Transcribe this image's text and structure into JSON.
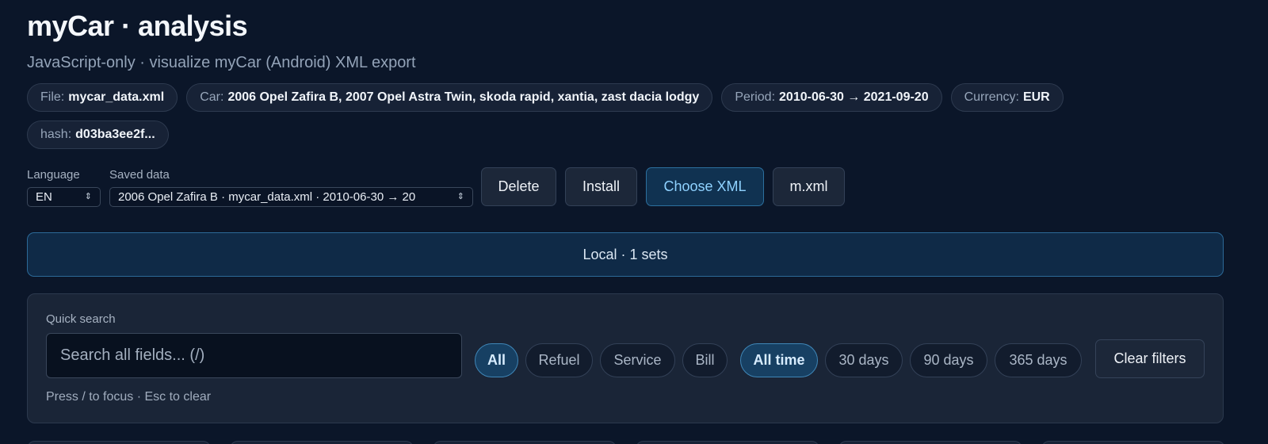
{
  "header": {
    "title": "myCar · analysis",
    "subtitle": "JavaScript-only · visualize myCar (Android) XML export"
  },
  "meta_chips": [
    {
      "label": "File:",
      "value": "mycar_data.xml"
    },
    {
      "label": "Car:",
      "value": "2006 Opel Zafira B, 2007 Opel Astra Twin, skoda rapid, xantia, zast dacia lodgy"
    },
    {
      "label": "Period:",
      "value": "2010-06-30 → 2021-09-20"
    },
    {
      "label": "Currency:",
      "value": "EUR"
    },
    {
      "label": "hash:",
      "value": "d03ba3ee2f..."
    }
  ],
  "controls": {
    "language_label": "Language",
    "language_value": "EN",
    "saved_label": "Saved data",
    "saved_value": "2006 Opel Zafira B · mycar_data.xml · 2010-06-30 → 20",
    "delete_label": "Delete",
    "install_label": "Install",
    "choose_label": "Choose XML",
    "file_label": "m.xml"
  },
  "local_bar": "Local · 1 sets",
  "filters": {
    "search_label": "Quick search",
    "search_placeholder": "Search all fields... (/)",
    "hint": "Press / to focus · Esc to clear",
    "type_pills": [
      "All",
      "Refuel",
      "Service",
      "Bill"
    ],
    "time_pills": [
      "All time",
      "30 days",
      "90 days",
      "365 days"
    ],
    "active_type": "All",
    "active_time": "All time",
    "clear_label": "Clear filters"
  },
  "colors": {
    "background": "#0b1629",
    "accent": "#8fd2ff",
    "accent_border": "#2c6f9e"
  },
  "icons": {
    "select_caret": "up-down-chevron-icon"
  }
}
